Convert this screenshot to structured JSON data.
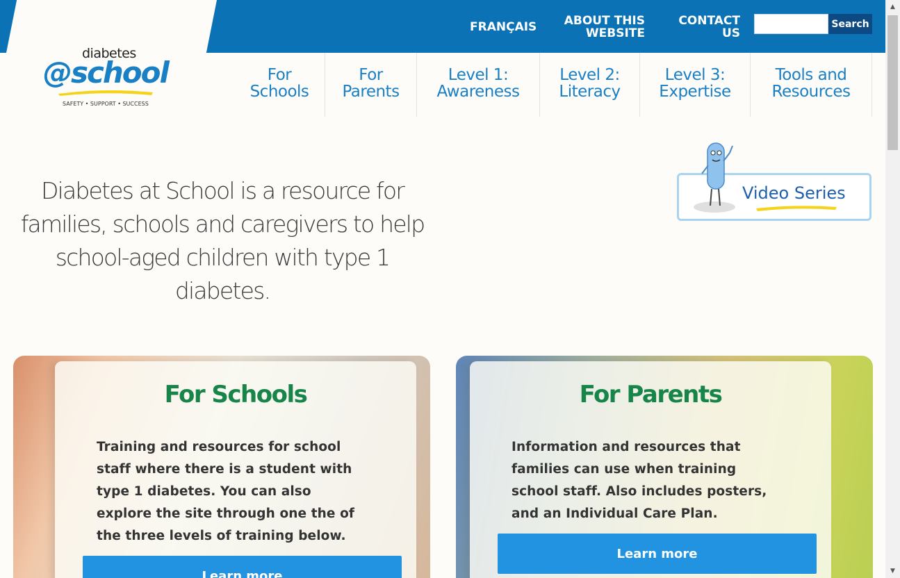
{
  "header": {
    "lang_link": "FRANÇAIS",
    "about_link": "ABOUT THIS WEBSITE",
    "contact_link": "CONTACT US",
    "search_value": "",
    "search_button": "Search",
    "brand_color": "#0a72b5"
  },
  "logo": {
    "top": "diabetes",
    "main": "@school",
    "tagline": "SAFETY • SUPPORT • SUCCESS"
  },
  "nav": {
    "items": [
      {
        "label_line1": "For",
        "label_line2": "Schools"
      },
      {
        "label_line1": "For",
        "label_line2": "Parents"
      },
      {
        "label_line1": "Level 1:",
        "label_line2": "Awareness"
      },
      {
        "label_line1": "Level 2:",
        "label_line2": "Literacy"
      },
      {
        "label_line1": "Level 3:",
        "label_line2": "Expertise"
      },
      {
        "label_line1": "Tools and",
        "label_line2": "Resources"
      }
    ]
  },
  "hero": {
    "text": "Diabetes at School is a resource for families, schools and caregivers to help school-aged children with type 1 diabetes.",
    "video_label": "Video Series"
  },
  "cards": [
    {
      "title": "For Schools",
      "body": "Training and resources for school staff where there is a student with type 1 diabetes. You can also explore the site through one the of the three levels of training below.",
      "button": "Learn more"
    },
    {
      "title": "For Parents",
      "body": "Information and resources that families can use when training school staff. Also includes posters, and an Individual Care Plan.",
      "button": "Learn more"
    }
  ]
}
